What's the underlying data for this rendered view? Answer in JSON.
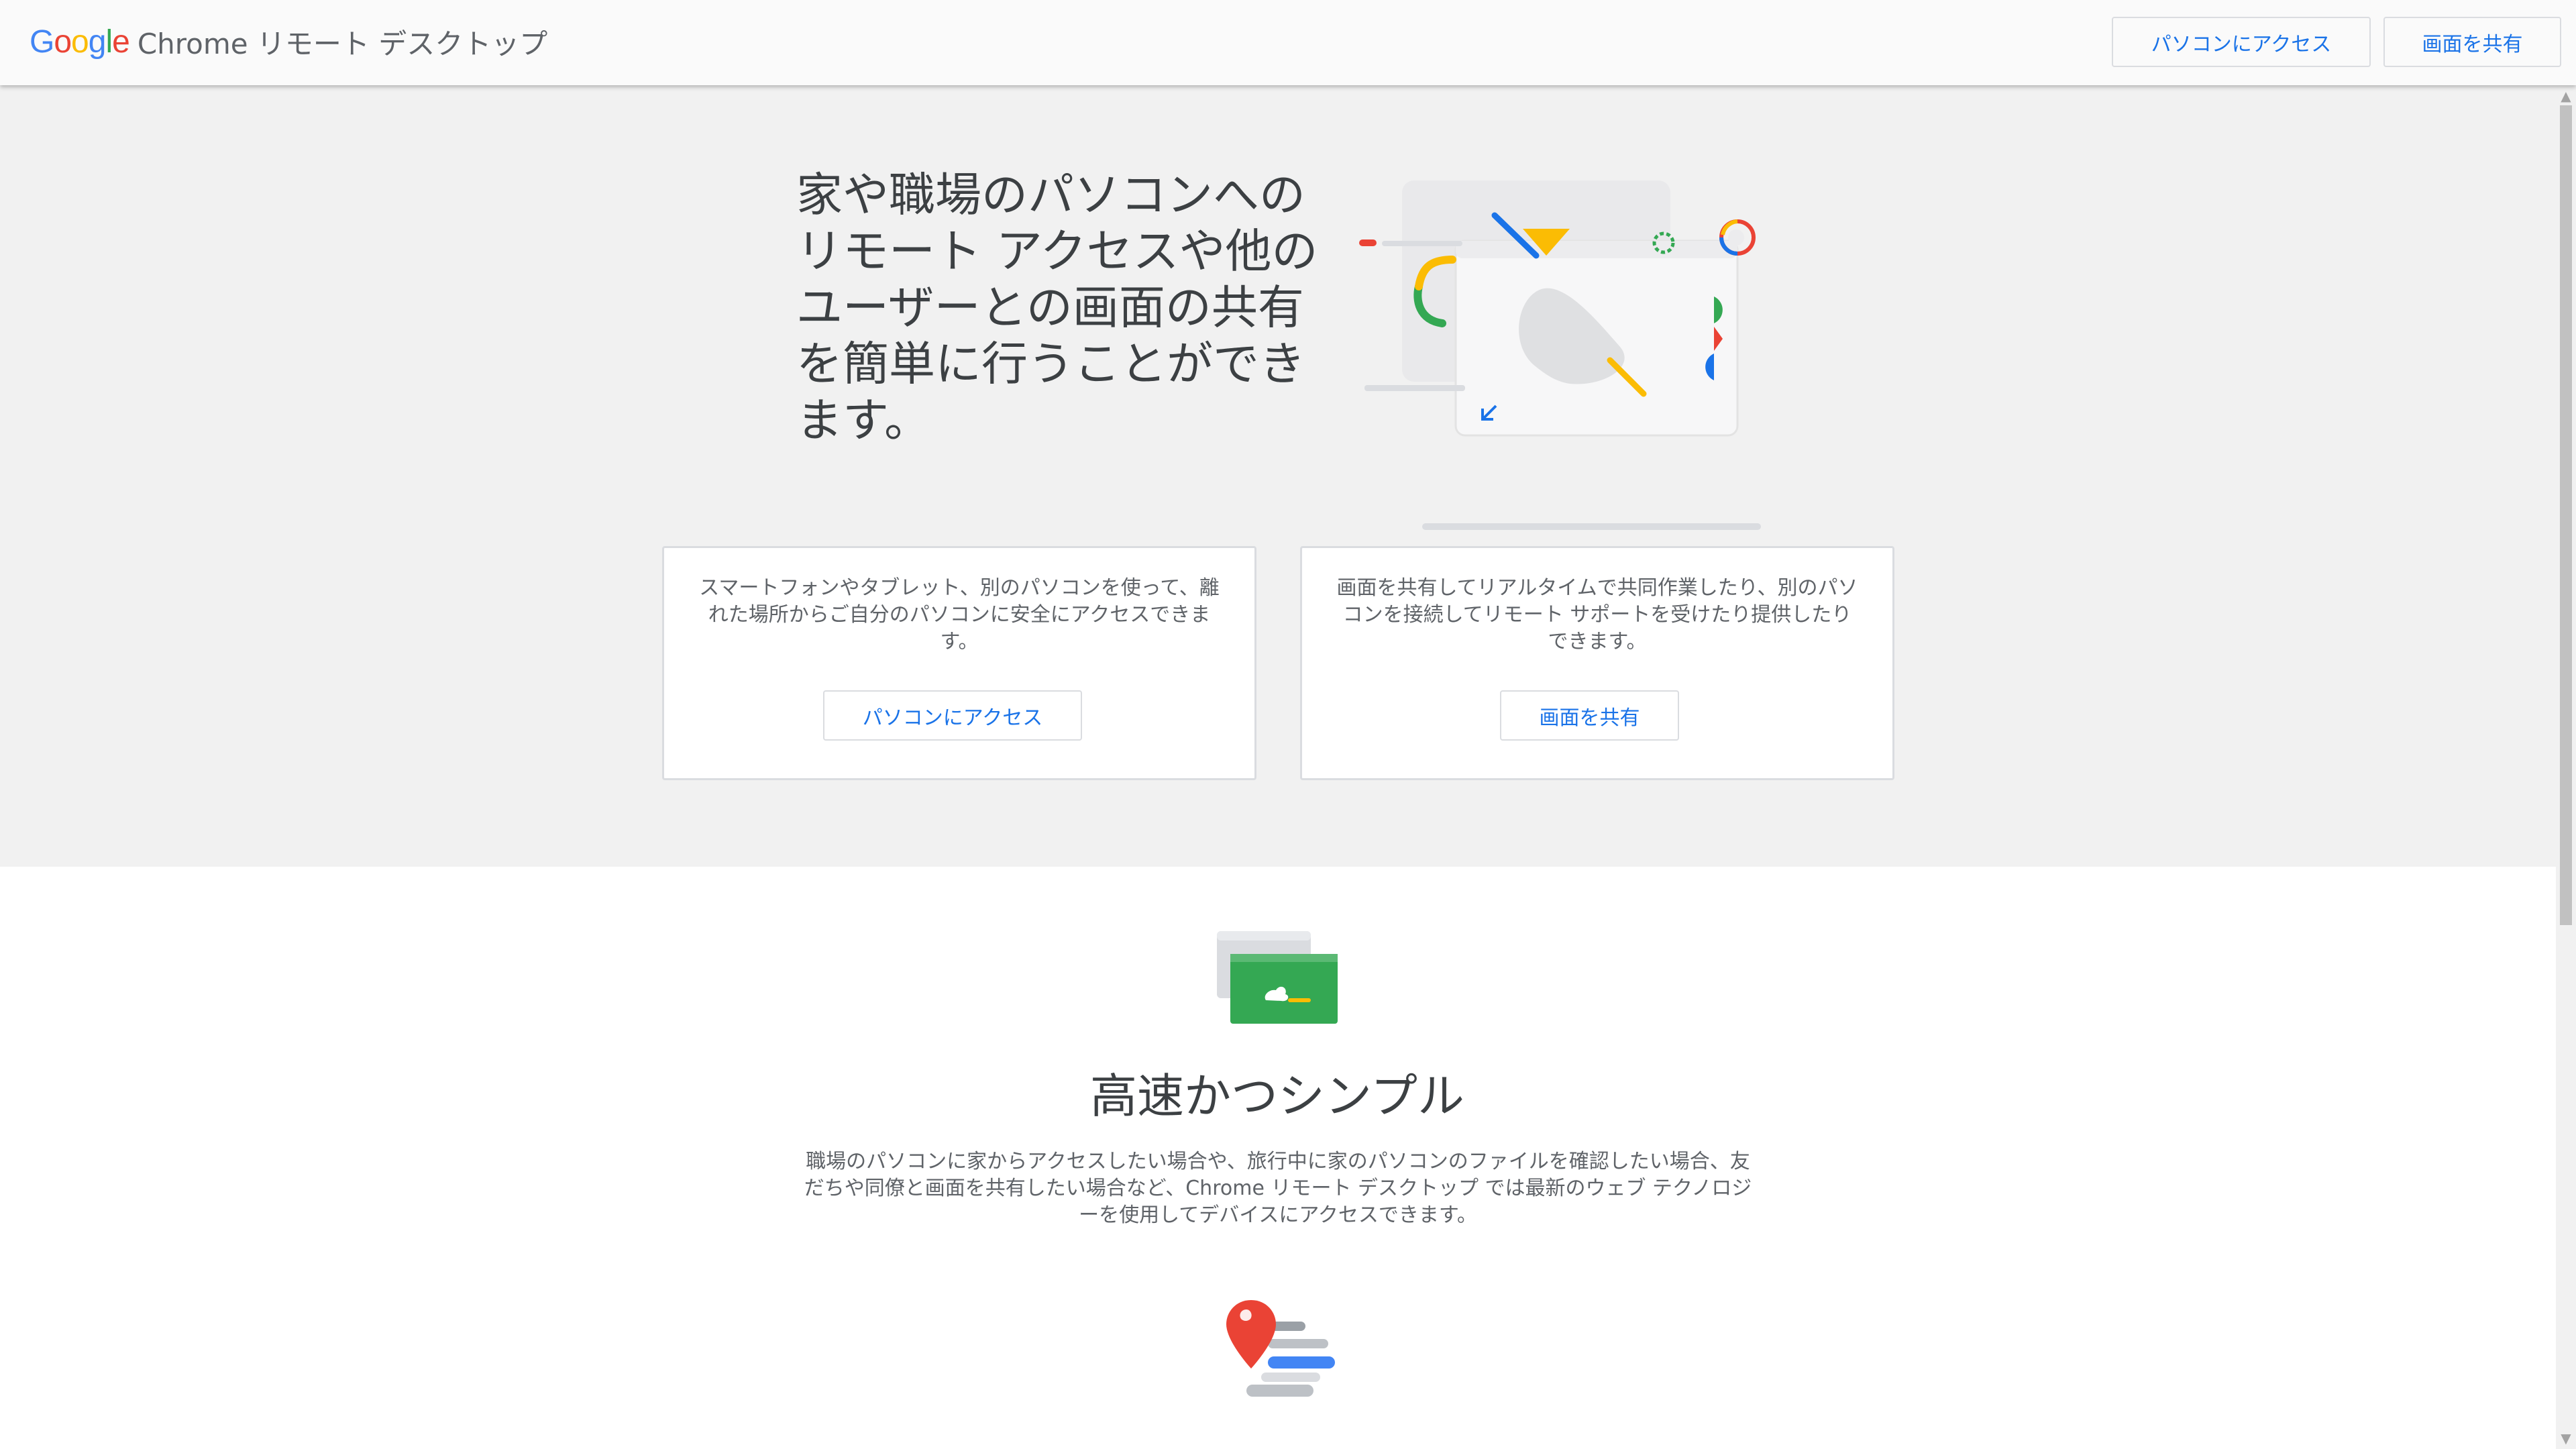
{
  "header": {
    "logo": {
      "letters": [
        "G",
        "o",
        "o",
        "g",
        "l",
        "e"
      ],
      "colors": [
        "#4285f4",
        "#ea4335",
        "#fbbc05",
        "#4285f4",
        "#34a853",
        "#ea4335"
      ]
    },
    "product_name": "Chrome リモート デスクトップ",
    "access_button": "パソコンにアクセス",
    "share_button": "画面を共有"
  },
  "hero": {
    "headline": "家や職場のパソコンへのリモート アクセスや他のユーザーとの画面の共有を簡単に行うことができます。",
    "illustration": "remote-desktop-illustration-icon"
  },
  "cards": [
    {
      "text": "スマートフォンやタブレット、別のパソコンを使って、離れた場所からご自分のパソコンに安全にアクセスできます。",
      "button": "パソコンにアクセス"
    },
    {
      "text": "画面を共有してリアルタイムで共同作業したり、別のパソコンを接続してリモート サポートを受けたり提供したりできます。",
      "button": "画面を共有"
    }
  ],
  "feature": {
    "icon": "fast-simple-icon",
    "title": "高速かつシンプル",
    "description": "職場のパソコンに家からアクセスしたい場合や、旅行中に家のパソコンのファイルを確認したい場合、友だちや同僚と画面を共有したい場合など、Chrome リモート デスクトップ では最新のウェブ テクノロジーを使用してデバイスにアクセスできます。"
  },
  "next_feature": {
    "icon": "location-pin-icon"
  },
  "colors": {
    "accent": "#1a73e8",
    "hero_bg": "#f1f1f1",
    "green": "#34a853",
    "red": "#ea4335",
    "yellow": "#fbbc04",
    "blue": "#4285f4"
  }
}
